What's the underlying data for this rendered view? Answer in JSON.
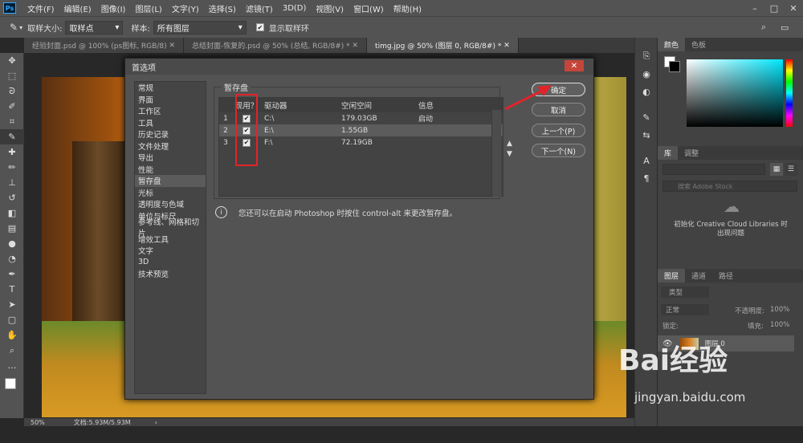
{
  "app": {
    "logo": "Ps"
  },
  "menu": [
    "文件(F)",
    "编辑(E)",
    "图像(I)",
    "图层(L)",
    "文字(Y)",
    "选择(S)",
    "滤镜(T)",
    "3D(D)",
    "视图(V)",
    "窗口(W)",
    "帮助(H)"
  ],
  "options": {
    "sample_size_label": "取样大小:",
    "sample_size_value": "取样点",
    "sample_label": "样本:",
    "sample_value": "所有图层",
    "show_ring_label": "显示取样环"
  },
  "doc_tabs": [
    "经验封面.psd @ 100% (ps图标, RGB/8)",
    "总结封面-恢复的.psd @ 50% (总结, RGB/8#) *",
    "timg.jpg @ 50% (图层 0, RGB/8#) *"
  ],
  "status": {
    "zoom": "50%",
    "doc": "文档:5.93M/5.93M"
  },
  "panels": {
    "color_tabs": [
      "颜色",
      "色板"
    ],
    "lib_tabs": [
      "库",
      "调整"
    ],
    "lib_search_placeholder": "搜索 Adobe Stock",
    "lib_message": "初始化 Creative Cloud Libraries 时出现问题",
    "layer_tabs": [
      "图层",
      "通道",
      "路径"
    ],
    "layer_kind": "类型",
    "blend_mode": "正常",
    "opacity_label": "不透明度:",
    "opacity_value": "100%",
    "lock_label": "锁定:",
    "fill_label": "填充:",
    "fill_value": "100%",
    "layer_name": "图层 0"
  },
  "dialog": {
    "title": "首选项",
    "nav": [
      "常规",
      "界面",
      "工作区",
      "工具",
      "历史记录",
      "文件处理",
      "导出",
      "性能",
      "暂存盘",
      "光标",
      "透明度与色域",
      "单位与标尺",
      "参考线、网格和切片",
      "增效工具",
      "文字",
      "3D",
      "技术预览"
    ],
    "selected_nav": "暂存盘",
    "group_title": "暂存盘",
    "columns": [
      "现用？",
      "驱动器",
      "空闲空间",
      "信息"
    ],
    "rows": [
      {
        "n": "1",
        "active": true,
        "drive": "C:\\",
        "free": "179.03GB",
        "info": "启动"
      },
      {
        "n": "2",
        "active": true,
        "drive": "E:\\",
        "free": "1.55GB",
        "info": ""
      },
      {
        "n": "3",
        "active": true,
        "drive": "F:\\",
        "free": "72.19GB",
        "info": ""
      }
    ],
    "info_text": "您还可以在启动 Photoshop 时按住 control-alt 来更改暂存盘。",
    "buttons": {
      "ok": "确定",
      "cancel": "取消",
      "prev": "上一个(P)",
      "next": "下一个(N)"
    }
  },
  "watermark": {
    "brand": "Bai经验",
    "url": "jingyan.baidu.com"
  },
  "colors": {
    "highlight": "#e0242a",
    "accent": "#31a8ff"
  }
}
